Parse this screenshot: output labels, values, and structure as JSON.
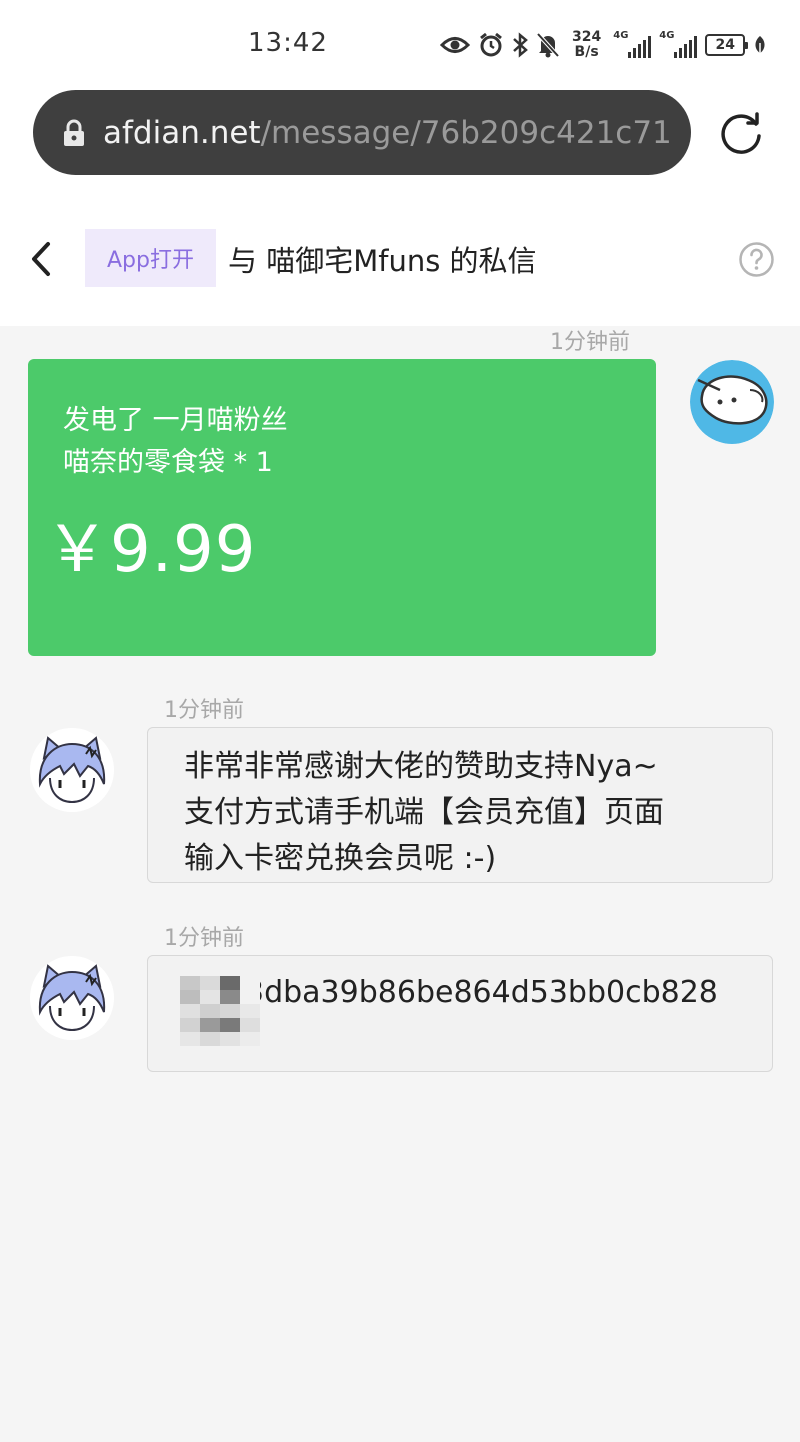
{
  "status_bar": {
    "time": "13:42",
    "net_speed_value": "324",
    "net_speed_unit": "B/s",
    "sim1_tag": "4G",
    "sim2_tag": "4G",
    "battery": "24"
  },
  "browser": {
    "url_host": "afdian.net",
    "url_path": "/message/76b209c421c71"
  },
  "header": {
    "app_open_label": "App打开",
    "title": "与 喵御宅Mfuns 的私信"
  },
  "messages": [
    {
      "time": "1分钟前",
      "sender": "me",
      "type": "payment",
      "line1": "发电了 一月喵粉丝",
      "line2": "喵奈的零食袋 * 1",
      "amount": "￥9.99"
    },
    {
      "time": "1分钟前",
      "sender": "creator",
      "type": "text",
      "text": "非常非常感谢大佬的赞助支持Nya~\n支付方式请手机端【会员充值】页面\n输入卡密兑换会员呢 :-)"
    },
    {
      "time": "1分钟前",
      "sender": "creator",
      "type": "text",
      "text": "3dba39b86be864d53bb0cb828"
    }
  ],
  "colors": {
    "payment_card": "#4cca6a",
    "accent_purple": "#8a6ee0",
    "my_avatar_bg": "#4fb8e6"
  },
  "icons": {
    "lock": "lock-icon",
    "reload": "reload-icon",
    "back": "chevron-left-icon",
    "help": "help-circle-icon"
  }
}
